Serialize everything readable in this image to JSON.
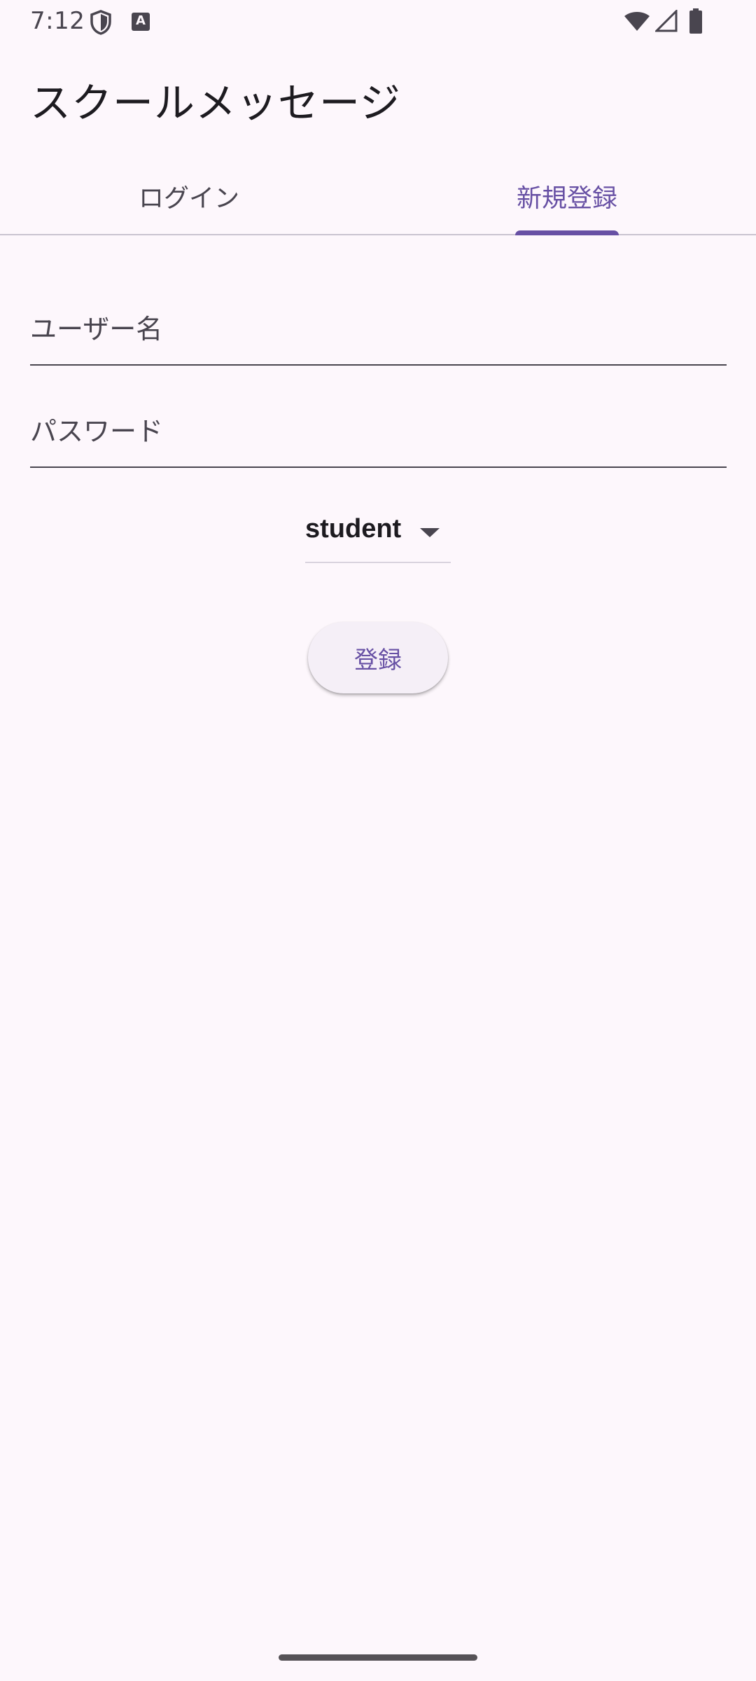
{
  "status_bar": {
    "time": "7:12",
    "icons": [
      "shield-icon",
      "keyboard-a-icon",
      "wifi-icon",
      "signal-icon",
      "battery-icon"
    ]
  },
  "app": {
    "title": "スクールメッセージ"
  },
  "tabs": [
    {
      "label": "ログイン",
      "active": false
    },
    {
      "label": "新規登録",
      "active": true
    }
  ],
  "form": {
    "username_placeholder": "ユーザー名",
    "password_placeholder": "パスワード",
    "role_selected": "student",
    "submit_label": "登録"
  },
  "colors": {
    "background": "#fdf7fc",
    "accent": "#6750a4",
    "text": "#1d1b20",
    "muted": "#49454f"
  }
}
